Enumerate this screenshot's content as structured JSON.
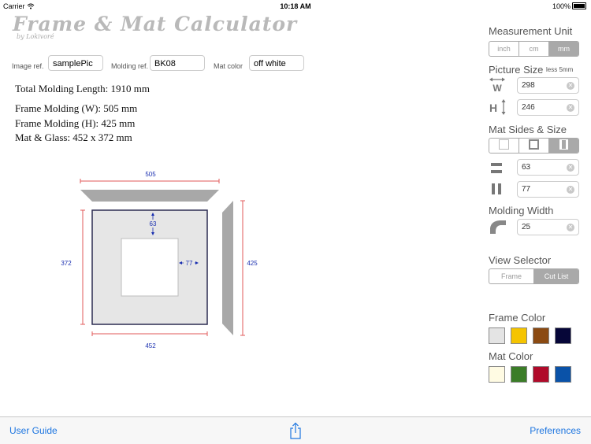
{
  "status": {
    "carrier": "Carrier",
    "time": "10:18 AM",
    "battery": "100%"
  },
  "header": {
    "title": "Frame & Mat Calculator",
    "subtitle": "by Lokivoré"
  },
  "refs": {
    "image_label": "Image ref.",
    "image_value": "samplePic",
    "molding_label": "Molding ref.",
    "molding_value": "BK08",
    "mat_label": "Mat color",
    "mat_value": "off white"
  },
  "summary": {
    "total": "Total Molding Length:  1910  mm",
    "frame_w": "Frame Molding (W):  505  mm",
    "frame_h": "Frame Molding (H):  425  mm",
    "mat_glass": "Mat & Glass:  452 x 372  mm"
  },
  "diagram": {
    "top_len": "505",
    "bottom_len": "452",
    "left_len": "372",
    "right_len": "425",
    "mat_top": "63",
    "mat_side": "77"
  },
  "sidebar": {
    "measurement_unit": {
      "title": "Measurement Unit",
      "options": [
        "inch",
        "cm",
        "mm"
      ],
      "selected": "mm"
    },
    "picture_size": {
      "title": "Picture Size",
      "note": "less 5mm",
      "width": "298",
      "height": "246"
    },
    "mat_sides": {
      "title": "Mat Sides & Size",
      "top": "63",
      "side": "77"
    },
    "molding_width": {
      "title": "Molding Width",
      "value": "25"
    },
    "view_selector": {
      "title": "View Selector",
      "options": [
        "Frame",
        "Cut List"
      ],
      "selected": "Cut List"
    },
    "frame_color": {
      "title": "Frame Color",
      "colors": [
        "#e4e4e4",
        "#f5c400",
        "#8b4a12",
        "#060638"
      ]
    },
    "mat_color": {
      "title": "Mat Color",
      "colors": [
        "#fffbe3",
        "#3b7d28",
        "#b00a2a",
        "#0a52a8"
      ]
    }
  },
  "bottom": {
    "user_guide": "User Guide",
    "preferences": "Preferences"
  }
}
